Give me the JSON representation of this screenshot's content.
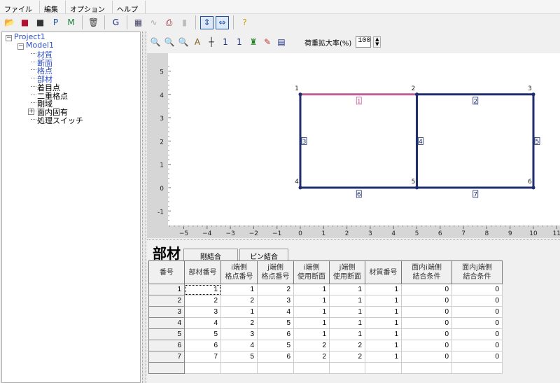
{
  "menu": [
    "ファイル",
    "編集",
    "オプション",
    "ヘルプ"
  ],
  "toolbar": [
    {
      "icon": "open-folder-icon",
      "g": "📂"
    },
    {
      "icon": "save-close-icon",
      "g": "■"
    },
    {
      "icon": "save-icon",
      "g": "■"
    },
    {
      "icon": "print-p-icon",
      "g": "P"
    },
    {
      "icon": "print-m-icon",
      "g": "M"
    },
    {
      "icon": "trash-icon",
      "g": "🗑"
    },
    {
      "icon": "grid-g-icon",
      "g": "G"
    },
    {
      "icon": "calculator-icon",
      "g": "▦"
    },
    {
      "icon": "wave-icon",
      "g": "∿"
    },
    {
      "icon": "printer-icon",
      "g": "⎙"
    },
    {
      "icon": "disabled-doc-icon",
      "g": "▮"
    },
    {
      "icon": "vertical-fit-icon",
      "g": "⇕"
    },
    {
      "icon": "horizontal-fit-icon",
      "g": "⇔"
    },
    {
      "icon": "help-icon",
      "g": "?"
    }
  ],
  "tree": {
    "project": "Project1",
    "model": "Model1",
    "items": [
      {
        "label": "材質",
        "blue": true
      },
      {
        "label": "断面",
        "blue": true
      },
      {
        "label": "格点",
        "blue": true
      },
      {
        "label": "部材",
        "blue": true
      },
      {
        "label": "着目点",
        "blue": false
      },
      {
        "label": "二重格点",
        "blue": false
      },
      {
        "label": "剛域",
        "blue": false
      },
      {
        "label": "面内固有",
        "blue": false,
        "expand": true
      },
      {
        "label": "処理スイッチ",
        "blue": false
      }
    ]
  },
  "viewtb": [
    {
      "icon": "zoom-fit-icon",
      "g": "🔍"
    },
    {
      "icon": "zoom-in-icon",
      "g": "🔍"
    },
    {
      "icon": "zoom-out-icon",
      "g": "🔍"
    },
    {
      "icon": "label-icon",
      "g": "A"
    },
    {
      "icon": "crosshair-icon",
      "g": "┼"
    },
    {
      "icon": "node-number-icon",
      "g": "1"
    },
    {
      "icon": "member-number-icon",
      "g": "1"
    },
    {
      "icon": "support-icon",
      "g": "♜"
    },
    {
      "icon": "edit-icon",
      "g": "✎"
    },
    {
      "icon": "window-icon",
      "g": "▤"
    }
  ],
  "load_scale": {
    "label": "荷重拡大率(%)",
    "value": "100"
  },
  "model": {
    "x_ticks": [
      -5,
      -4,
      -3,
      -2,
      -1,
      0,
      1,
      2,
      3,
      4,
      5,
      6,
      7,
      8,
      9,
      10,
      11
    ],
    "y_ticks": [
      5,
      4,
      3,
      2,
      1,
      0,
      -1
    ],
    "nodes": [
      {
        "id": "1",
        "x": 0,
        "y": 4
      },
      {
        "id": "2",
        "x": 5,
        "y": 4
      },
      {
        "id": "3",
        "x": 10,
        "y": 4
      },
      {
        "id": "4",
        "x": 0,
        "y": 0
      },
      {
        "id": "5",
        "x": 5,
        "y": 0
      },
      {
        "id": "6",
        "x": 10,
        "y": 0
      }
    ],
    "members": [
      {
        "id": "1",
        "i": 1,
        "j": 2,
        "selected": true
      },
      {
        "id": "2",
        "i": 2,
        "j": 3
      },
      {
        "id": "3",
        "i": 1,
        "j": 4
      },
      {
        "id": "4",
        "i": 2,
        "j": 5
      },
      {
        "id": "5",
        "i": 3,
        "j": 6
      },
      {
        "id": "6",
        "i": 4,
        "j": 5
      },
      {
        "id": "7",
        "i": 5,
        "j": 6
      }
    ],
    "colors": {
      "member": "#1f2f6e",
      "selected": "#c0609a"
    }
  },
  "panel": {
    "title": "部材",
    "tabs": [
      "剛結合",
      "ピン結合"
    ]
  },
  "table": {
    "headers": [
      [
        "番号"
      ],
      [
        "部材番号"
      ],
      [
        "i端側",
        "格点番号"
      ],
      [
        "j端側",
        "格点番号"
      ],
      [
        "i端側",
        "使用断面"
      ],
      [
        "j端側",
        "使用断面"
      ],
      [
        "材質番号"
      ],
      [
        "面内i端側",
        "結合条件"
      ],
      [
        "面内j端側",
        "結合条件"
      ]
    ],
    "rows": [
      [
        "1",
        "1",
        "1",
        "2",
        "1",
        "1",
        "1",
        "0",
        "0"
      ],
      [
        "2",
        "2",
        "2",
        "3",
        "1",
        "1",
        "1",
        "0",
        "0"
      ],
      [
        "3",
        "3",
        "1",
        "4",
        "1",
        "1",
        "1",
        "0",
        "0"
      ],
      [
        "4",
        "4",
        "2",
        "5",
        "1",
        "1",
        "1",
        "0",
        "0"
      ],
      [
        "5",
        "5",
        "3",
        "6",
        "1",
        "1",
        "1",
        "0",
        "0"
      ],
      [
        "6",
        "6",
        "4",
        "5",
        "2",
        "2",
        "1",
        "0",
        "0"
      ],
      [
        "7",
        "7",
        "5",
        "6",
        "2",
        "2",
        "1",
        "0",
        "0"
      ]
    ]
  }
}
